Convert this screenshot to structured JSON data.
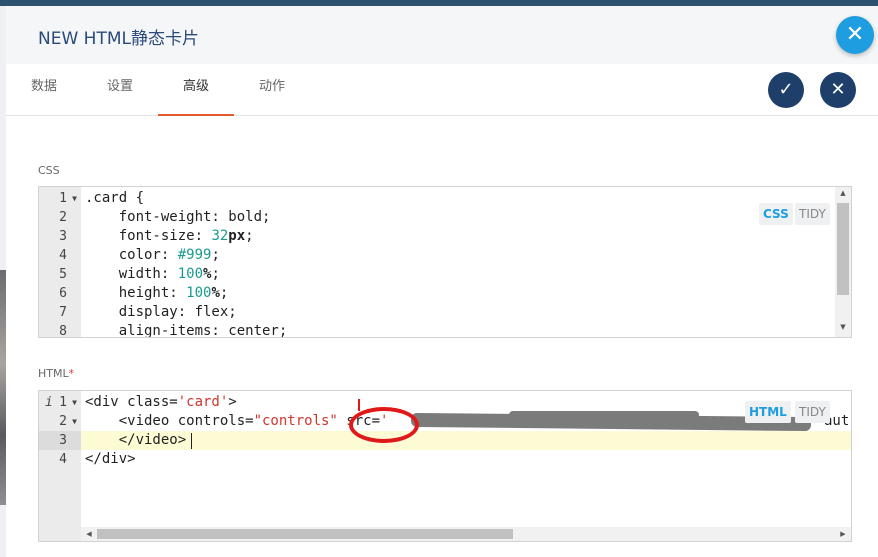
{
  "dialog": {
    "title": "NEW HTML静态卡片"
  },
  "tabs": [
    {
      "label": "数据"
    },
    {
      "label": "设置"
    },
    {
      "label": "高级"
    },
    {
      "label": "动作"
    }
  ],
  "active_tab": "高级",
  "buttons": {
    "close_fab": "✕",
    "confirm": "✓",
    "cancel": "✕"
  },
  "css_section": {
    "label": "CSS",
    "chip_css": "CSS",
    "chip_tidy": "TIDY",
    "line_numbers": [
      "1",
      "2",
      "3",
      "4",
      "5",
      "6",
      "7",
      "8"
    ]
  },
  "html_section": {
    "label": "HTML",
    "required_mark": "*",
    "chip_html": "HTML",
    "chip_tidy": "TIDY",
    "line_numbers": [
      "1",
      "2",
      "3",
      "4"
    ],
    "info_mark": "i"
  },
  "css_code": {
    "l1_selector": ".card",
    "l1_brace": " {",
    "l2_prop": "    font-weight: bold;",
    "l3_prop": "    font-size: ",
    "l3_num": "32",
    "l3_unit": "px",
    "l3_end": ";",
    "l4_prop": "    color: ",
    "l4_hex": "#999",
    "l4_end": ";",
    "l5_prop": "    width: ",
    "l5_num": "100",
    "l5_unit": "%",
    "l5_end": ";",
    "l6_prop": "    height: ",
    "l6_num": "100",
    "l6_unit": "%",
    "l6_end": ";",
    "l7_prop": "    display: flex;",
    "l8_prop": "    align-items: center;"
  },
  "html_code": {
    "l1_open": "<div class=",
    "l1_str": "'card'",
    "l1_close": ">",
    "l2_open": "    <video controls=",
    "l2_str": "\"controls\"",
    "l2_src": " src=",
    "l2_quote": "'",
    "l2_tail": "aut",
    "l3_close": "    </video>",
    "l4_close": "</div>"
  },
  "colors": {
    "accent_blue": "#1e9de0",
    "navy_button": "#1f3f6b",
    "active_tab_underline": "#e55a2b",
    "annotation_red": "#e01818"
  }
}
